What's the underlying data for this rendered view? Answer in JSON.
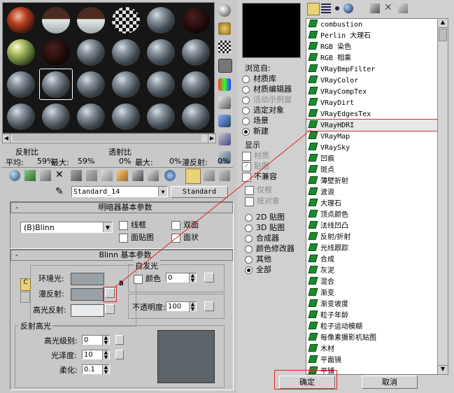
{
  "left": {
    "stats_row1": {
      "reflectance": "反射比",
      "transmittance": "透射比"
    },
    "stats_row2": {
      "avg_label": "平均:",
      "avg": "59%",
      "max_label": "最大:",
      "max": "59%",
      "avg2": "0%",
      "max2_label": "最大:",
      "max2": "0%",
      "diffuse_label": "漫反射:",
      "diffuse": "0%"
    },
    "material_name": "Standard_14",
    "material_type": "Standard",
    "shader_rollout": {
      "title": "明暗器基本参数",
      "shader": "(B)Blinn",
      "wire": "线框",
      "two_sided": "双面",
      "face_map": "面贴图",
      "faceted": "面状"
    },
    "blinn_rollout": {
      "title": "Blinn 基本参数",
      "self_illum_title": "自发光",
      "ambient": "环境光:",
      "diffuse": "漫反射:",
      "specular": "高光反射:",
      "color_label": "颜色",
      "self_illum_value": "0",
      "opacity_label": "不透明度:",
      "opacity_value": "100",
      "lock_icon_letter": "C",
      "diffuse_map_letter": "B"
    },
    "spec_highlights": {
      "title": "反射高光",
      "level_label": "高光级别:",
      "level_value": "0",
      "gloss_label": "光泽度:",
      "gloss_value": "10",
      "soften_label": "柔化:",
      "soften_value": "0.1"
    }
  },
  "browser": {
    "browse_from_title": "浏览自:",
    "browse_from": [
      {
        "label": "材质库",
        "checked": false,
        "disabled": false
      },
      {
        "label": "材质编辑器",
        "checked": false,
        "disabled": false
      },
      {
        "label": "活动示例窗",
        "checked": false,
        "disabled": true
      },
      {
        "label": "选定对象",
        "checked": false,
        "disabled": false
      },
      {
        "label": "场景",
        "checked": false,
        "disabled": false
      },
      {
        "label": "新建",
        "checked": true,
        "disabled": false
      }
    ],
    "show_title": "显示",
    "show": [
      {
        "label": "材质",
        "checked": false,
        "disabled": true
      },
      {
        "label": "贴图",
        "checked": true,
        "disabled": true
      },
      {
        "label": "不兼容",
        "checked": false,
        "disabled": false
      }
    ],
    "root_only": "仅根",
    "by_object": "按对象",
    "map_types": [
      {
        "label": "2D 贴图",
        "checked": false
      },
      {
        "label": "3D 贴图",
        "checked": false
      },
      {
        "label": "合成器",
        "checked": false
      },
      {
        "label": "颜色修改器",
        "checked": false
      },
      {
        "label": "其他",
        "checked": false
      },
      {
        "label": "全部",
        "checked": true
      }
    ],
    "maps": [
      "combustion",
      "Perlin 大理石",
      "RGB 染色",
      "RGB 相乘",
      "VRayBmpFilter",
      "VRayColor",
      "VRayCompTex",
      "VRayDirt",
      "VRayEdgesTex",
      "VRayHDRI",
      "VRayMap",
      "VRaySky",
      "凹痕",
      "斑点",
      "薄壁折射",
      "波浪",
      "大理石",
      "顶点颜色",
      "法线凹凸",
      "反射/折射",
      "光线跟踪",
      "合成",
      "灰泥",
      "混合",
      "渐变",
      "渐变坡度",
      "粒子年龄",
      "粒子运动模糊",
      "每像素摄影机贴图",
      "木材",
      "平面镜",
      "平铺"
    ],
    "selected_map": "VRayHDRI",
    "ok": "确定",
    "cancel": "取消"
  }
}
